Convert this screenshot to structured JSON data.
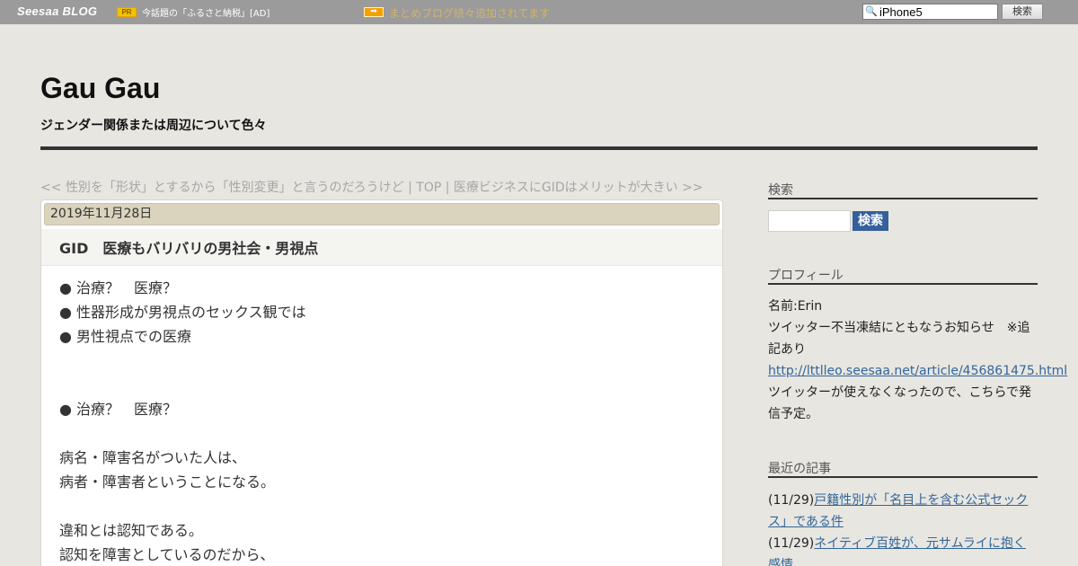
{
  "topbar": {
    "logo": "Seesaa BLOG",
    "pr_badge": "PR",
    "pr_link": "今話題の「ふるさと納税」[AD]",
    "arrow_icon": "arrow-right-icon",
    "news_link": "まとめブログ続々追加されてます",
    "search_icon": "magnifier-icon",
    "search_value": "iPhone5",
    "search_button": "検索"
  },
  "header": {
    "title": "Gau Gau",
    "description": "ジェンダー関係または周辺について色々"
  },
  "article_nav": {
    "prev": "<< 性別を「形状」とするから「性別変更」と言うのだろうけど",
    "sep1": " | ",
    "top": "TOP",
    "sep2": " | ",
    "next": "医療ビジネスにGIDはメリットが大きい >>"
  },
  "article": {
    "date": "2019年11月28日",
    "title": "GID　医療もバリバリの男社会・男視点",
    "lines": [
      "● 治療？　医療？",
      "● 性器形成が男視点のセックス観では",
      "● 男性視点での医療",
      "",
      "",
      "● 治療？　医療？",
      "",
      "病名・障害名がついた人は、",
      "病者・障害者ということになる。",
      "",
      "違和とは認知である。",
      "認知を障害としているのだから、"
    ]
  },
  "sidebar": {
    "search_heading": "検索",
    "search_button": "検索",
    "profile_heading": "プロフィール",
    "profile_name": "名前:Erin",
    "profile_notice": "ツイッター不当凍結にともなうお知らせ　※追記あり",
    "profile_link": "http://lttlleo.seesaa.net/article/456861475.html",
    "profile_note": "ツイッターが使えなくなったので、こちらで発信予定。",
    "recent_heading": "最近の記事",
    "recent": [
      {
        "date": "(11/29)",
        "title": "戸籍性別が「名目上を含む公式セックス」である件"
      },
      {
        "date": "(11/29)",
        "title": "ネイティブ百姓が、元サムライに抱く感情"
      }
    ]
  },
  "colors": {
    "page_bg": "#e8e6e1",
    "topbar_bg": "#9b9b9b",
    "link": "#336699",
    "date_bar": "#dad4be",
    "search_button": "#36609a"
  }
}
